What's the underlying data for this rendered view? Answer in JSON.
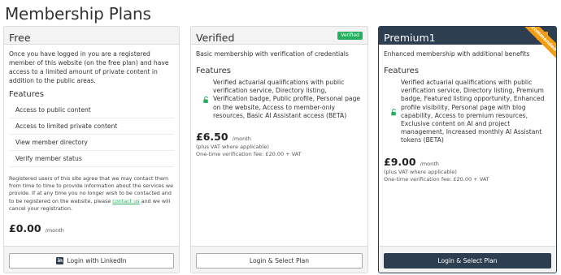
{
  "page": {
    "title": "Membership Plans"
  },
  "colors": {
    "accent_green": "#27ae60",
    "premium_navy": "#2d3e50",
    "ribbon_orange": "#f39c12"
  },
  "free": {
    "title": "Free",
    "description": "Once you have logged in you are a registered member of this website (on the free plan) and have access to a limited amount of private content in addition to the public areas.",
    "features_heading": "Features",
    "features": [
      "Access to public content",
      "Access to limited private content",
      "View member directory",
      "Verify member status"
    ],
    "legal_before": "Registered users of this site agree that we may contact them from time to time to provide information about the services we provide. If at any time you no longer wish to be contacted and to be registered on the website, please ",
    "legal_link": "contact us",
    "legal_after": " and we will cancel your registration.",
    "price": "£0.00",
    "price_unit": "/month",
    "button_label": "Login with LinkedIn",
    "button_icon": "linkedin-icon",
    "button_icon_glyph": "in"
  },
  "verified": {
    "title": "Verified",
    "badge": "Verified",
    "description": "Basic membership with verification of credentials",
    "features_heading": "Features",
    "feature_text": "Verified actuarial qualifications with public verification service, Directory listing, Verification badge, Public profile, Personal page on the website, Access to member-only resources, Basic AI Assistant access (BETA)",
    "price": "£6.50",
    "price_unit": "/month",
    "vat_note": "(plus VAT where applicable)",
    "verification_fee": "One-time verification fee: £20.00 + VAT",
    "button_label": "Login & Select Plan"
  },
  "premium": {
    "title": "Premium1",
    "ribbon": "Recommended",
    "description": "Enhanced membership with additional benefits",
    "features_heading": "Features",
    "feature_text": "Verified actuarial qualifications with public verification service, Directory listing, Premium badge, Featured listing opportunity, Enhanced profile visibility, Personal page with blog capability, Access to premium resources, Exclusive content on AI and project management, Increased monthly AI Assistant tokens (BETA)",
    "price": "£9.00",
    "price_unit": "/month",
    "vat_note": "(plus VAT where applicable)",
    "verification_fee": "One-time verification fee: £20.00 + VAT",
    "button_label": "Login & Select Plan"
  }
}
